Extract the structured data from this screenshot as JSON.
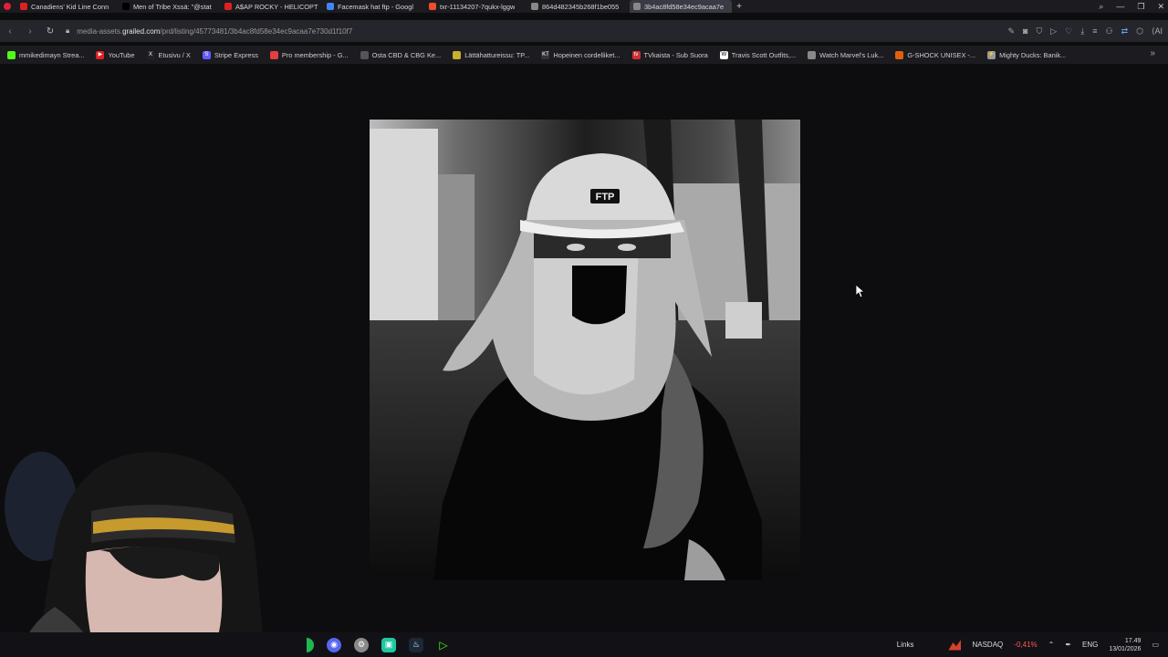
{
  "tabs": [
    {
      "title": "Canadiens' Kid Line Conn",
      "icon": "youtube-icon",
      "color": "#e02020",
      "active": false
    },
    {
      "title": "Men of Tribe Xssä: \"@stat",
      "icon": "x-icon",
      "color": "#000000",
      "active": false
    },
    {
      "title": "A$AP ROCKY - HELICOPT",
      "icon": "youtube-icon",
      "color": "#e02020",
      "active": false
    },
    {
      "title": "Facemask hat ftp - Googl",
      "icon": "google-icon",
      "color": "#4285f4",
      "active": false
    },
    {
      "title": "txr-11134207-7qukx-lggw",
      "icon": "shopee-icon",
      "color": "#ee4d2d",
      "active": false
    },
    {
      "title": "864d482345b268f1be055",
      "icon": "document-icon",
      "color": "#888888",
      "active": false
    },
    {
      "title": "3b4ac8fd58e34ec9acaa7e",
      "icon": "document-icon",
      "color": "#888888",
      "active": true
    }
  ],
  "address": {
    "prefix": "media-assets.",
    "domain": "grailed.com",
    "path": "/prd/listing/45773481/3b4ac8fd58e34ec9acaa7e730d1f10f7"
  },
  "bookmarks": [
    {
      "label": "mmikedimayn Strea...",
      "icon": "kick-icon",
      "color": "#53fc18",
      "glyph": ""
    },
    {
      "label": "YouTube",
      "icon": "youtube-icon",
      "color": "#e02020",
      "glyph": "▶"
    },
    {
      "label": "Etusivu / X",
      "icon": "x-icon",
      "color": "#222222",
      "glyph": "X"
    },
    {
      "label": "Stripe Express",
      "icon": "stripe-icon",
      "color": "#635bff",
      "glyph": "S"
    },
    {
      "label": "Pro membership - G...",
      "icon": "location-pin-icon",
      "color": "#e04040",
      "glyph": ""
    },
    {
      "label": "Osta CBD & CBG Ke...",
      "icon": "globe-icon",
      "color": "#555555",
      "glyph": ""
    },
    {
      "label": "Lättähattureissu: TP...",
      "icon": "car-icon",
      "color": "#c8b030",
      "glyph": ""
    },
    {
      "label": "Hopeinen cordelliket...",
      "icon": "kt-icon",
      "color": "#333333",
      "glyph": "KT"
    },
    {
      "label": "TVkaista - Sub Suora",
      "icon": "tv-icon",
      "color": "#d03030",
      "glyph": "tv"
    },
    {
      "label": "Travis Scott Outfits,...",
      "icon": "w-icon",
      "color": "#ffffff",
      "glyph": "W"
    },
    {
      "label": "Watch Marvel's Luk...",
      "icon": "swirl-icon",
      "color": "#888888",
      "glyph": ""
    },
    {
      "label": "G-SHOCK UNISEX -...",
      "icon": "gshock-icon",
      "color": "#e06010",
      "glyph": ""
    },
    {
      "label": "Mighty Ducks: Banik...",
      "icon": "lightning-icon",
      "color": "#999999",
      "glyph": "⚡"
    }
  ],
  "photo": {
    "cap_text": "FTP"
  },
  "taskbar": {
    "links_label": "Links",
    "stock_name": "NASDAQ",
    "stock_change": "-0,41%",
    "language": "ENG",
    "time": "17.49",
    "date": "13/01/2026"
  }
}
